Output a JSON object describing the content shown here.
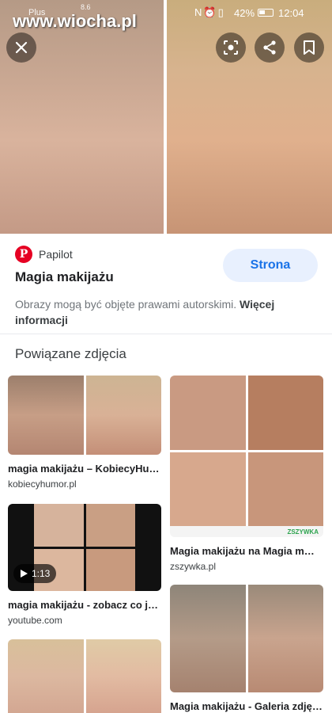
{
  "status_bar": {
    "carrier": "Plus",
    "speed": "8.6",
    "battery_percent": "42%",
    "time": "12:04"
  },
  "watermark": "www.wiocha.pl",
  "viewer": {
    "close_icon": "close-icon",
    "lens_icon": "lens-icon",
    "share_icon": "share-icon",
    "bookmark_icon": "bookmark-icon"
  },
  "result": {
    "source_name": "Papilot",
    "title": "Magia makijażu",
    "visit_label": "Strona",
    "notice_text": "Obrazy mogą być objęte prawami autorskimi.",
    "notice_more": "Więcej informacji"
  },
  "related": {
    "heading": "Powiązane zdjęcia",
    "items": [
      {
        "title": "magia makijażu – KobiecyHu…",
        "source": "kobiecyhumor.pl"
      },
      {
        "title": "Magia makijażu na Magia m…",
        "source": "zszywka.pl",
        "banner": "ZSZYWKA"
      },
      {
        "title": "magia makijażu - zobacz co j…",
        "source": "youtube.com",
        "duration": "1:13"
      },
      {
        "title": "Magia makijażu - Galeria zdję…",
        "source": ""
      },
      {
        "title": "",
        "source": ""
      }
    ]
  },
  "colors": {
    "accent": "#1a73e8",
    "pinterest": "#e60023",
    "button_bg": "#e8f0fe"
  }
}
